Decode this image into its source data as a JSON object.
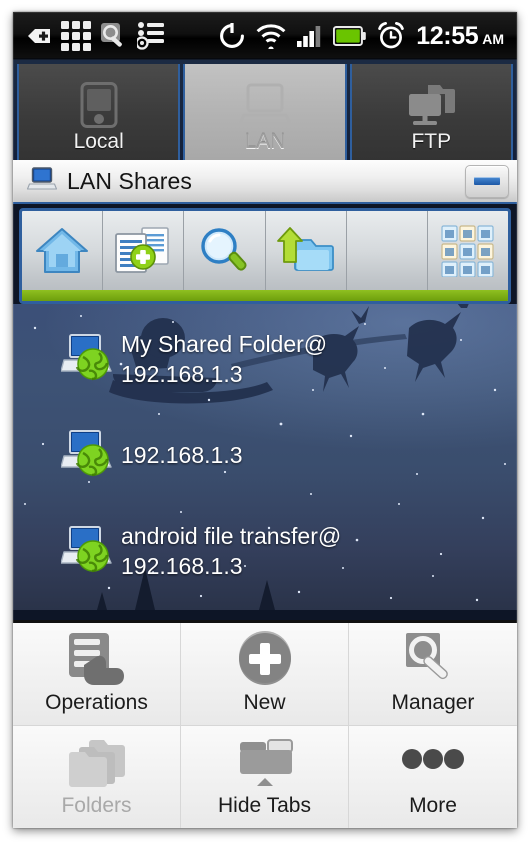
{
  "status_bar": {
    "icons_left": [
      "back-arrow-icon",
      "app-grid-icon",
      "settings-search-icon",
      "task-list-icon"
    ],
    "icons_right": [
      "sync-icon",
      "wifi-icon",
      "signal-icon",
      "battery-icon",
      "alarm-clock-icon"
    ],
    "time": "12:55",
    "meridiem": "AM",
    "battery_color": "#6ac400"
  },
  "tabs": [
    {
      "label": "Local",
      "icon": "phone-device-icon",
      "active": false
    },
    {
      "label": "LAN",
      "icon": "laptop-icon",
      "active": true
    },
    {
      "label": "FTP",
      "icon": "monitor-folder-icon",
      "active": false
    }
  ],
  "window": {
    "title": "LAN Shares",
    "title_icon": "laptop-icon",
    "minimize_label": "minimize",
    "accent_border": "#2f5f9e",
    "accent_green": "#7fb216"
  },
  "toolbar": {
    "items": [
      {
        "name": "home",
        "icon": "home-icon"
      },
      {
        "name": "new-share",
        "icon": "new-document-icon"
      },
      {
        "name": "search",
        "icon": "magnifier-icon"
      },
      {
        "name": "up-folder",
        "icon": "up-arrow-folder-icon"
      },
      {
        "name": "empty",
        "icon": ""
      },
      {
        "name": "grid-view",
        "icon": "grid-thumbnails-icon"
      }
    ]
  },
  "shares": [
    {
      "icon": "laptop-globe-icon",
      "name": "My Shared Folder@\n192.168.1.3",
      "line1": "My Shared Folder@",
      "line2": "192.168.1.3"
    },
    {
      "icon": "laptop-globe-icon",
      "name": "192.168.1.3",
      "line1": "192.168.1.3",
      "line2": ""
    },
    {
      "icon": "laptop-globe-icon",
      "name": "android file transfer@\n192.168.1.3",
      "line1": "android file transfer@",
      "line2": "192.168.1.3"
    }
  ],
  "menu": [
    {
      "label": "Operations",
      "icon": "list-hand-icon",
      "enabled": true
    },
    {
      "label": "New",
      "icon": "plus-circle-icon",
      "enabled": true
    },
    {
      "label": "Manager",
      "icon": "wrench-icon",
      "enabled": true
    },
    {
      "label": "Folders",
      "icon": "folders-icon",
      "enabled": false
    },
    {
      "label": "Hide Tabs",
      "icon": "tabs-up-icon",
      "enabled": true
    },
    {
      "label": "More",
      "icon": "ellipsis-icon",
      "enabled": true
    }
  ]
}
